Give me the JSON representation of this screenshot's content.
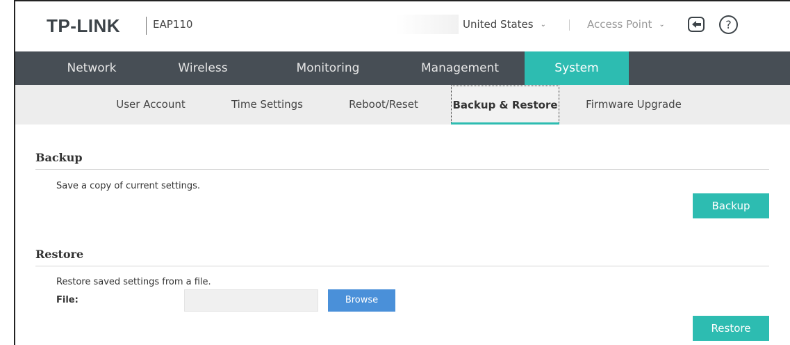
{
  "header": {
    "logo": "TP-LINK",
    "model": "EAP110",
    "country": "United States",
    "mode": "Access Point",
    "help_glyph": "?"
  },
  "mainnav": {
    "items": [
      {
        "label": "Network"
      },
      {
        "label": "Wireless"
      },
      {
        "label": "Monitoring"
      },
      {
        "label": "Management"
      },
      {
        "label": "System"
      }
    ],
    "active": "System"
  },
  "subnav": {
    "items": [
      {
        "label": "User Account"
      },
      {
        "label": "Time Settings"
      },
      {
        "label": "Reboot/Reset"
      },
      {
        "label": "Backup & Restore"
      },
      {
        "label": "Firmware Upgrade"
      }
    ],
    "active": "Backup & Restore"
  },
  "backup": {
    "title": "Backup",
    "description": "Save a copy of current settings.",
    "button_label": "Backup"
  },
  "restore": {
    "title": "Restore",
    "description": "Restore saved settings from a file.",
    "file_label": "File:",
    "file_value": "",
    "browse_label": "Browse",
    "button_label": "Restore"
  },
  "colors": {
    "accent": "#2dbcb1",
    "nav_bg": "#474e55",
    "subnav_bg": "#ededed",
    "browse": "#4a90d9"
  },
  "icons": {
    "logout": "logout-icon",
    "help": "help-icon",
    "chevron": "chevron-down-icon"
  }
}
